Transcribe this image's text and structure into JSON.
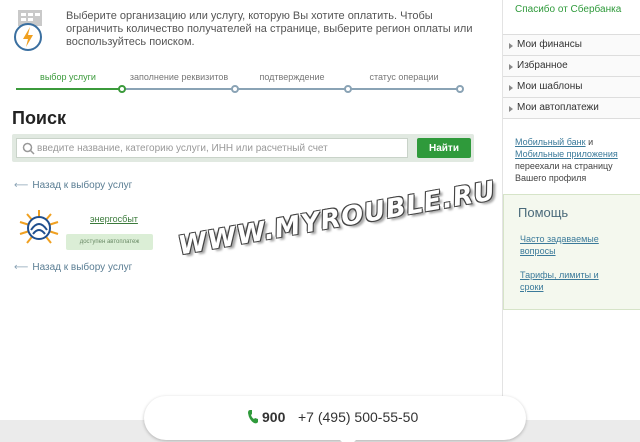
{
  "intro": {
    "text": "Выберите организацию или услугу, которую Вы хотите оплатить. Чтобы ограничить количество получателей на странице, выберите регион оплаты или воспользуйтесь поиском.",
    "icon": "payment-terminal-icon"
  },
  "steps": [
    {
      "label": "выбор услуги",
      "active": true
    },
    {
      "label": "заполнение реквизитов",
      "active": false
    },
    {
      "label": "подтверждение",
      "active": false
    },
    {
      "label": "статус операции",
      "active": false
    }
  ],
  "page_title": "Поиск",
  "search": {
    "placeholder": "введите название, категорию услуги, ИНН или расчетный счет",
    "value": "",
    "button_label": "Найти"
  },
  "back_link": "Назад к выбору услуг",
  "provider": {
    "name": "энергосбыт",
    "badge": "доступен автоплатеж",
    "logo": "energosbyt-logo"
  },
  "watermark": "WWW.MYROUBLE.RU",
  "sidebar": {
    "thanks": "Спасибо от Сбербанка",
    "menu": [
      "Мои финансы",
      "Избранное",
      "Мои шаблоны",
      "Мои автоплатежи"
    ],
    "note": {
      "link1": "Мобильный банк",
      "and": " и ",
      "link2": "Мобильные приложения",
      "rest": " переехали на страницу Вашего профиля"
    },
    "help": {
      "title": "Помощь",
      "faq": "Часто задаваемые вопросы",
      "tariffs": "Тарифы, лимиты и сроки"
    }
  },
  "footer": {
    "short_number": "900",
    "full_number": "+7 (495) 500-55-50"
  },
  "colors": {
    "accent_green": "#2f9a3b",
    "step_inactive": "#8aa3b5",
    "link_blue": "#3b7a9a"
  }
}
